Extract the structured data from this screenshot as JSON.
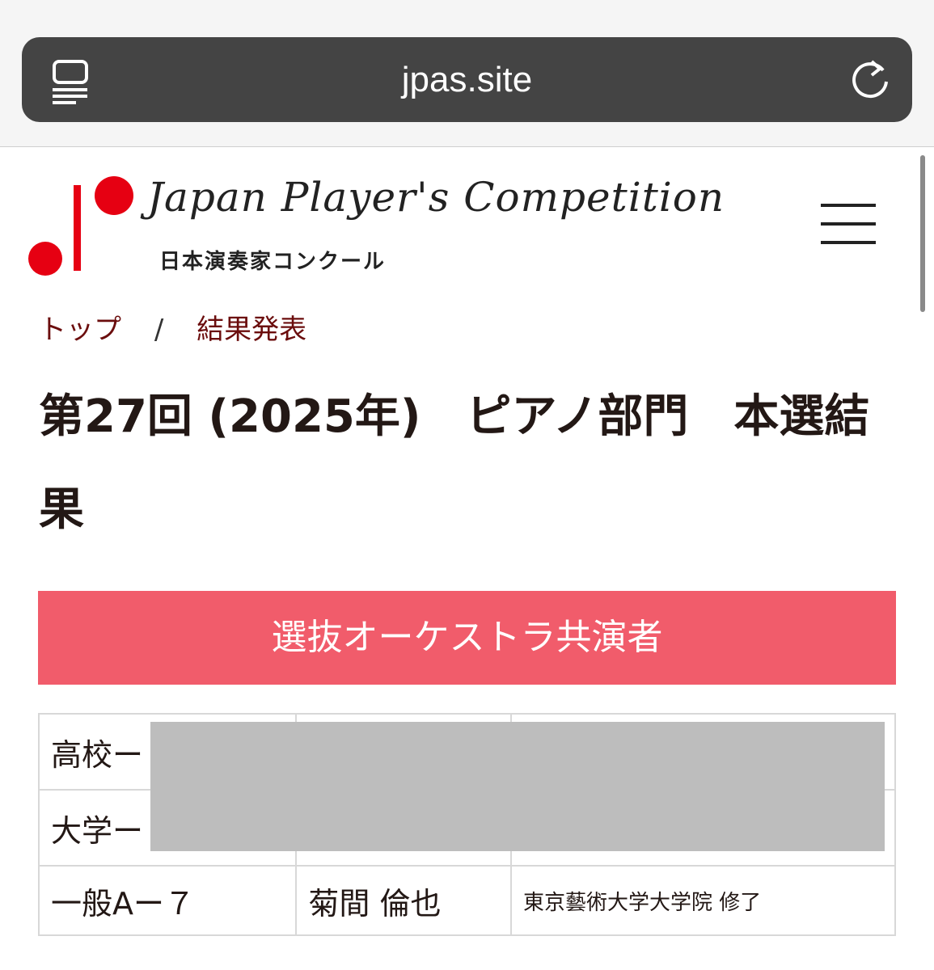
{
  "browser": {
    "url": "jpas.site",
    "reader_icon": "reader-mode-icon",
    "reload_icon": "reload-icon"
  },
  "header": {
    "logo_script": "Japan Player's Competition",
    "logo_sub": "日本演奏家コンクール",
    "logo_color": "#e60012",
    "menu_icon": "hamburger-menu-icon"
  },
  "breadcrumb": {
    "items": [
      "トップ",
      "結果発表"
    ],
    "separator": "/"
  },
  "page": {
    "title": "第27回 (2025年)　ピアノ部門　本選結果"
  },
  "section": {
    "heading": "選抜オーケストラ共演者",
    "color": "#f15c6b"
  },
  "results": {
    "rows": [
      {
        "category": "高校ー",
        "name": "",
        "school": ""
      },
      {
        "category": "大学ー",
        "name": "",
        "school": ""
      },
      {
        "category": "一般Aー７",
        "name": "菊間 倫也",
        "school": "東京藝術大学大学院 修了"
      }
    ]
  }
}
